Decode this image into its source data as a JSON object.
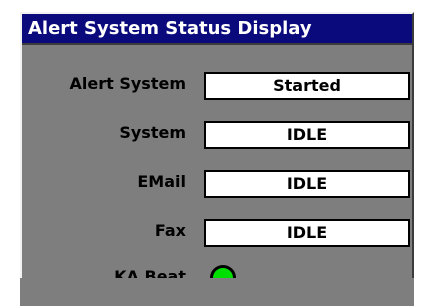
{
  "window": {
    "title": "Alert System Status Display"
  },
  "status_rows": [
    {
      "label": "Alert System",
      "value": "Started"
    },
    {
      "label": "System",
      "value": "IDLE"
    },
    {
      "label": "EMail",
      "value": "IDLE"
    },
    {
      "label": "Fax",
      "value": "IDLE"
    }
  ],
  "heartbeat": {
    "label": "KA Beat",
    "indicator_color": "#00e000",
    "indicator_state": "on"
  },
  "colors": {
    "title_bar": "#0a0a7c",
    "panel_background": "#7e7e7e",
    "field_background": "#ffffff"
  }
}
